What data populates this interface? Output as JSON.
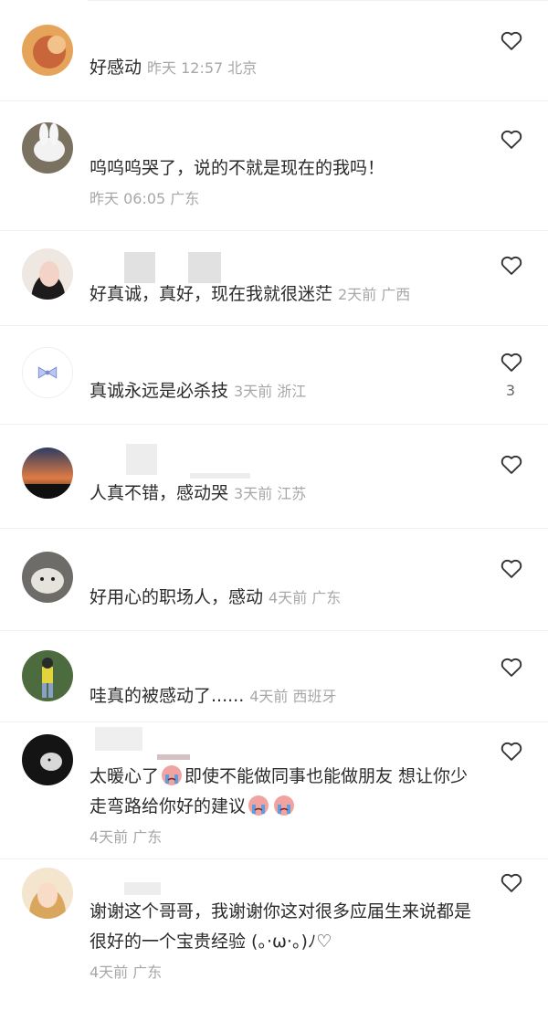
{
  "comments": [
    {
      "text": "好感动",
      "meta": "昨天 12:57 北京"
    },
    {
      "text": "呜呜呜哭了，说的不就是现在的我吗！",
      "meta": "昨天 06:05 广东"
    },
    {
      "text": "好真诚，真好，现在我就很迷茫",
      "meta": "2天前 广西"
    },
    {
      "text": "真诚永远是必杀技",
      "meta": "3天前 浙江",
      "likes": "3"
    },
    {
      "text": "人真不错，感动哭",
      "meta": "3天前 江苏"
    },
    {
      "text": "好用心的职场人，感动",
      "meta": "4天前 广东"
    },
    {
      "text": "哇真的被感动了......",
      "meta": "4天前 西班牙"
    },
    {
      "text_part1": "太暖心了",
      "text_part2": "即使不能做同事也能做朋友 想让你少走弯路给你好的建议",
      "meta": "4天前 广东"
    },
    {
      "text": "谢谢这个哥哥，我谢谢你这对很多应届生来说都是很好的一个宝贵经验 (。·ω·。)ﾉ♡",
      "meta": "4天前 广东"
    }
  ],
  "icons": {
    "like": "heart-outline-icon",
    "emoji": "crying-emoji-icon"
  },
  "colors": {
    "text": "#2b2b2b",
    "meta": "#a7a7a7",
    "divider": "#f0f0f0"
  }
}
